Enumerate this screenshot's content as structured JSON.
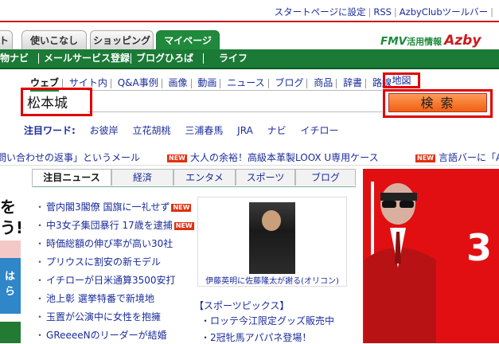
{
  "top_links": [
    "スタートページに設定",
    "RSS",
    "AzbyClubツールバー"
  ],
  "tabs": [
    "ト",
    "使いこなし",
    "ショッピング",
    "マイページ"
  ],
  "brand": {
    "main": "FMV",
    "sub": "活用情報",
    "azby": "Azby"
  },
  "green_nav": [
    "物ナビ",
    "メールサービス登録",
    "ブログひろば",
    "ライフ"
  ],
  "search": {
    "tabs": [
      "ウェブ",
      "サイト内",
      "Q&A事例",
      "画像",
      "動画",
      "ニュース",
      "ブログ",
      "商品",
      "辞書",
      "路線"
    ],
    "selected_tab": "ウェブ",
    "map_tab": "地図",
    "query": "松本城",
    "button": "検 索"
  },
  "trending": {
    "label": "注目ワード:",
    "words": [
      "お彼岸",
      "立花胡桃",
      "三浦春馬",
      "JRA",
      "ナビ",
      "イチロー"
    ]
  },
  "ticker": [
    "問い合わせの返事」というメール",
    "大人の余裕！高級本革製LOOX U専用ケース",
    "言語バーに「A"
  ],
  "new_badge": "NEW",
  "news": {
    "tabs": [
      "注目ニュース",
      "経済",
      "エンタメ",
      "スポーツ",
      "ブログ"
    ],
    "selected_tab": "注目ニュース",
    "items": [
      "菅内閣3閣僚 国旗に一礼せず",
      "中3女子集団暴行 17歳を逮捕",
      "時価総額の伸び率が高い30社",
      "プリウスに割安の新モデル",
      "イチローが日米通算3500安打",
      "池上彰 選挙特番で新境地",
      "玉置が公演中に女性を抱擁",
      "GReeeeNのリーダーが結婚"
    ],
    "new_flags": [
      true,
      true,
      false,
      false,
      false,
      false,
      false,
      false
    ],
    "photo_caption": "伊藤英明に佐藤隆太が謝る(オリコン)"
  },
  "sports": {
    "heading": "【スポーツピックス】",
    "items": [
      "ロッテ今江限定グッズ販売中",
      "2冠牝馬アパパネ登場！"
    ]
  },
  "left_col": {
    "t1": "を",
    "t2": "う!",
    "blue": "は\nら"
  },
  "ad": {
    "number": "3"
  }
}
